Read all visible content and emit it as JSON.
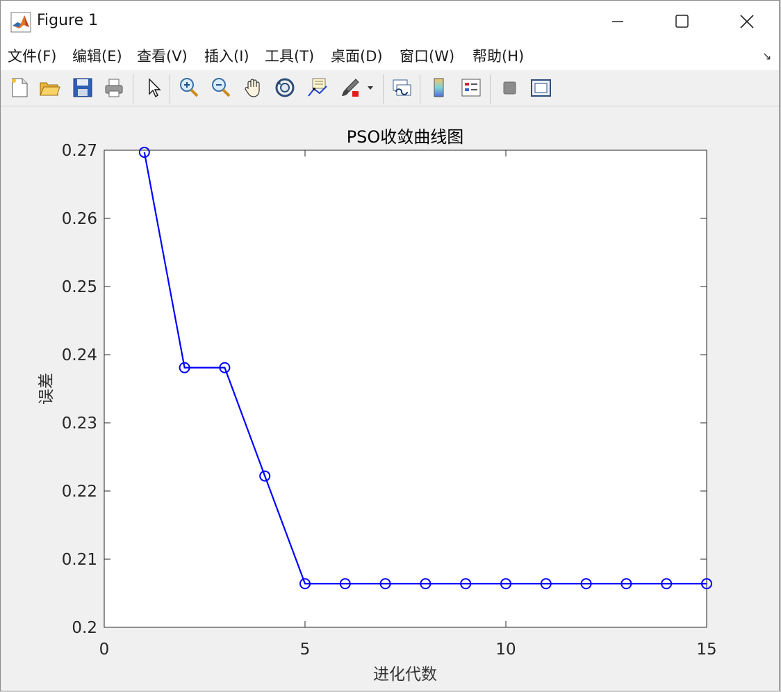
{
  "window": {
    "title": "Figure 1"
  },
  "menu": [
    "文件(F)",
    "编辑(E)",
    "查看(V)",
    "插入(I)",
    "工具(T)",
    "桌面(D)",
    "窗口(W)",
    "帮助(H)"
  ],
  "toolbar": [
    {
      "name": "new-figure-icon"
    },
    {
      "name": "open-file-icon"
    },
    {
      "name": "save-icon"
    },
    {
      "name": "print-icon"
    },
    {
      "name": "select-arrow-icon"
    },
    {
      "name": "zoom-in-icon"
    },
    {
      "name": "zoom-out-icon"
    },
    {
      "name": "pan-hand-icon"
    },
    {
      "name": "rotate-3d-icon"
    },
    {
      "name": "data-cursor-icon"
    },
    {
      "name": "brush-icon"
    },
    {
      "name": "brush-dropdown-icon"
    },
    {
      "name": "link-plot-icon"
    },
    {
      "name": "colorbar-icon"
    },
    {
      "name": "legend-icon"
    },
    {
      "name": "hide-plot-tools-icon"
    },
    {
      "name": "show-plot-tools-icon"
    }
  ],
  "chart_data": {
    "type": "line",
    "title": "PSO收敛曲线图",
    "xlabel": "进化代数",
    "ylabel": "误差",
    "xlim": [
      0,
      15
    ],
    "ylim": [
      0.2,
      0.27
    ],
    "xticks": [
      "0",
      "5",
      "10",
      "15"
    ],
    "yticks": [
      "0.2",
      "0.21",
      "0.22",
      "0.23",
      "0.24",
      "0.25",
      "0.26",
      "0.27"
    ],
    "grid": false,
    "marker": "circle",
    "color": "#0000ff",
    "series": [
      {
        "x": [
          1,
          2,
          3,
          4,
          5,
          6,
          7,
          8,
          9,
          10,
          11,
          12,
          13,
          14,
          15
        ],
        "values": [
          0.2697,
          0.2381,
          0.2381,
          0.2222,
          0.2064,
          0.2064,
          0.2064,
          0.2064,
          0.2064,
          0.2064,
          0.2064,
          0.2064,
          0.2064,
          0.2064,
          0.2064
        ]
      }
    ]
  }
}
